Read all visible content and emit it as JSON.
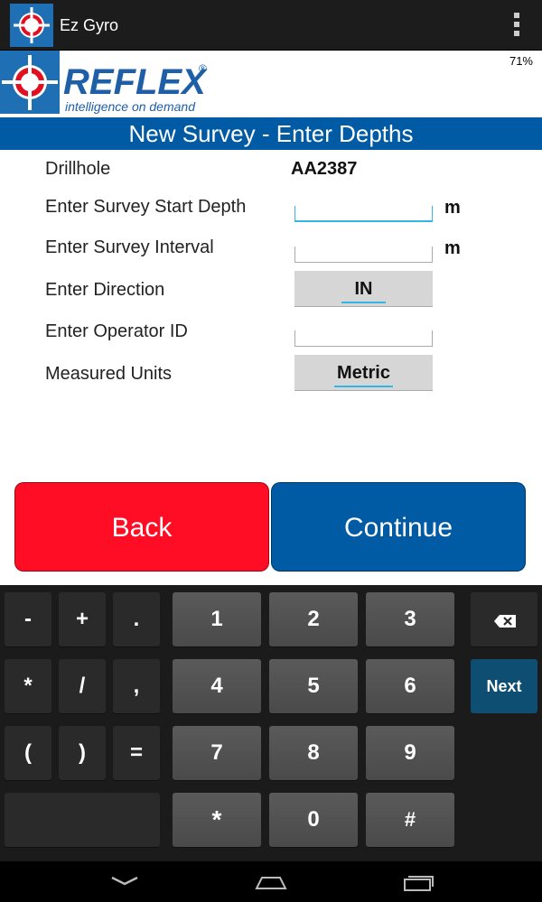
{
  "app": {
    "title": "Ez Gyro",
    "battery": "71%"
  },
  "logo": {
    "brand": "REFLEX",
    "registered": "®",
    "tagline": "intelligence on demand"
  },
  "header": {
    "title": "New Survey - Enter Depths"
  },
  "form": {
    "drillhole_label": "Drillhole",
    "drillhole_value": "AA2387",
    "start_depth_label": "Enter Survey Start Depth",
    "start_depth_value": "",
    "interval_label": "Enter Survey Interval",
    "interval_value": "",
    "unit": "m",
    "direction_label": "Enter Direction",
    "direction_value": "IN",
    "operator_label": "Enter Operator ID",
    "operator_value": "",
    "units_label": "Measured Units",
    "units_value": "Metric"
  },
  "buttons": {
    "back": "Back",
    "continue": "Continue"
  },
  "keyboard": {
    "sym_keys": [
      "-",
      "+",
      ".",
      "*",
      "/",
      ",",
      "(",
      ")",
      "="
    ],
    "num_keys": [
      "1",
      "2",
      "3",
      "4",
      "5",
      "6",
      "7",
      "8",
      "9",
      "*",
      "0",
      "#"
    ],
    "next": "Next"
  },
  "colors": {
    "accent_blue": "#005ba4",
    "back_red": "#ff0d24",
    "focus": "#33b5e5"
  }
}
